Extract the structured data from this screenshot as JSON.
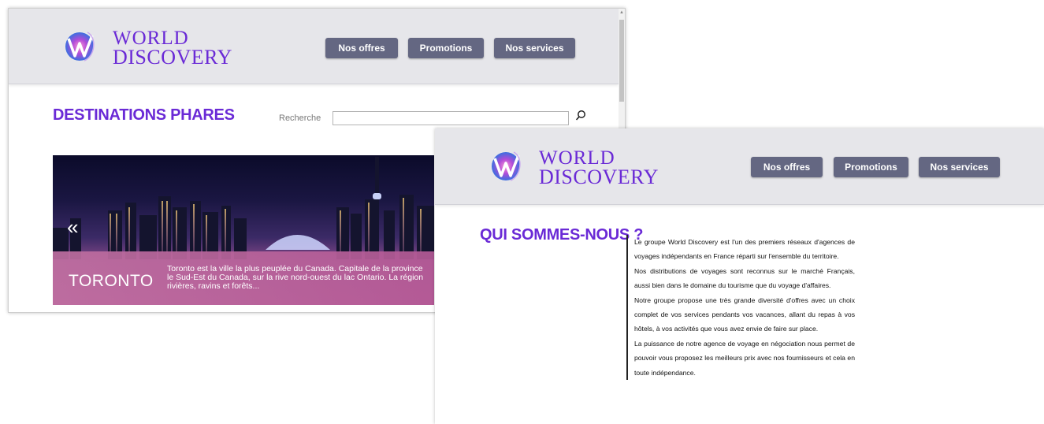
{
  "brand": {
    "line1": "WORLD",
    "line2": "DISCOVERY"
  },
  "nav": {
    "offers": "Nos offres",
    "promotions": "Promotions",
    "services": "Nos services"
  },
  "home": {
    "heading": "DESTINATIONS PHARES",
    "search": {
      "label": "Recherche",
      "value": "",
      "icon": "search-icon"
    },
    "slide": {
      "title": "TORONTO",
      "description": "Toronto est la ville la plus peuplée du Canada. Capitale de la province\nle Sud-Est du Canada, sur la rive nord-ouest du lac Ontario. La région\nrivières, ravins et forêts..."
    }
  },
  "about": {
    "heading": "QUI SOMMES-NOUS ?",
    "paragraphs": [
      "Le groupe World Discovery est l'un des premiers réseaux d'agences de voyages indépendants en France réparti sur l'ensemble du territoire.",
      "Nos distributions de voyages sont reconnus sur le marché Français, aussi bien dans le domaine du tourisme que du voyage d'affaires.",
      "Notre groupe propose une très grande diversité d'offres avec un choix complet de vos services pendants vos vacances, allant du repas à vos hôtels, à vos activités que vous avez envie de faire sur place.",
      "La puissance de notre agence de voyage en négociation nous permet de pouvoir vous proposez les meilleurs prix avec nos fournisseurs et cela en toute indépendance."
    ]
  },
  "colors": {
    "accent": "#6a2ad6",
    "nav_button": "#646782",
    "header_bg": "#e6e6ea"
  }
}
